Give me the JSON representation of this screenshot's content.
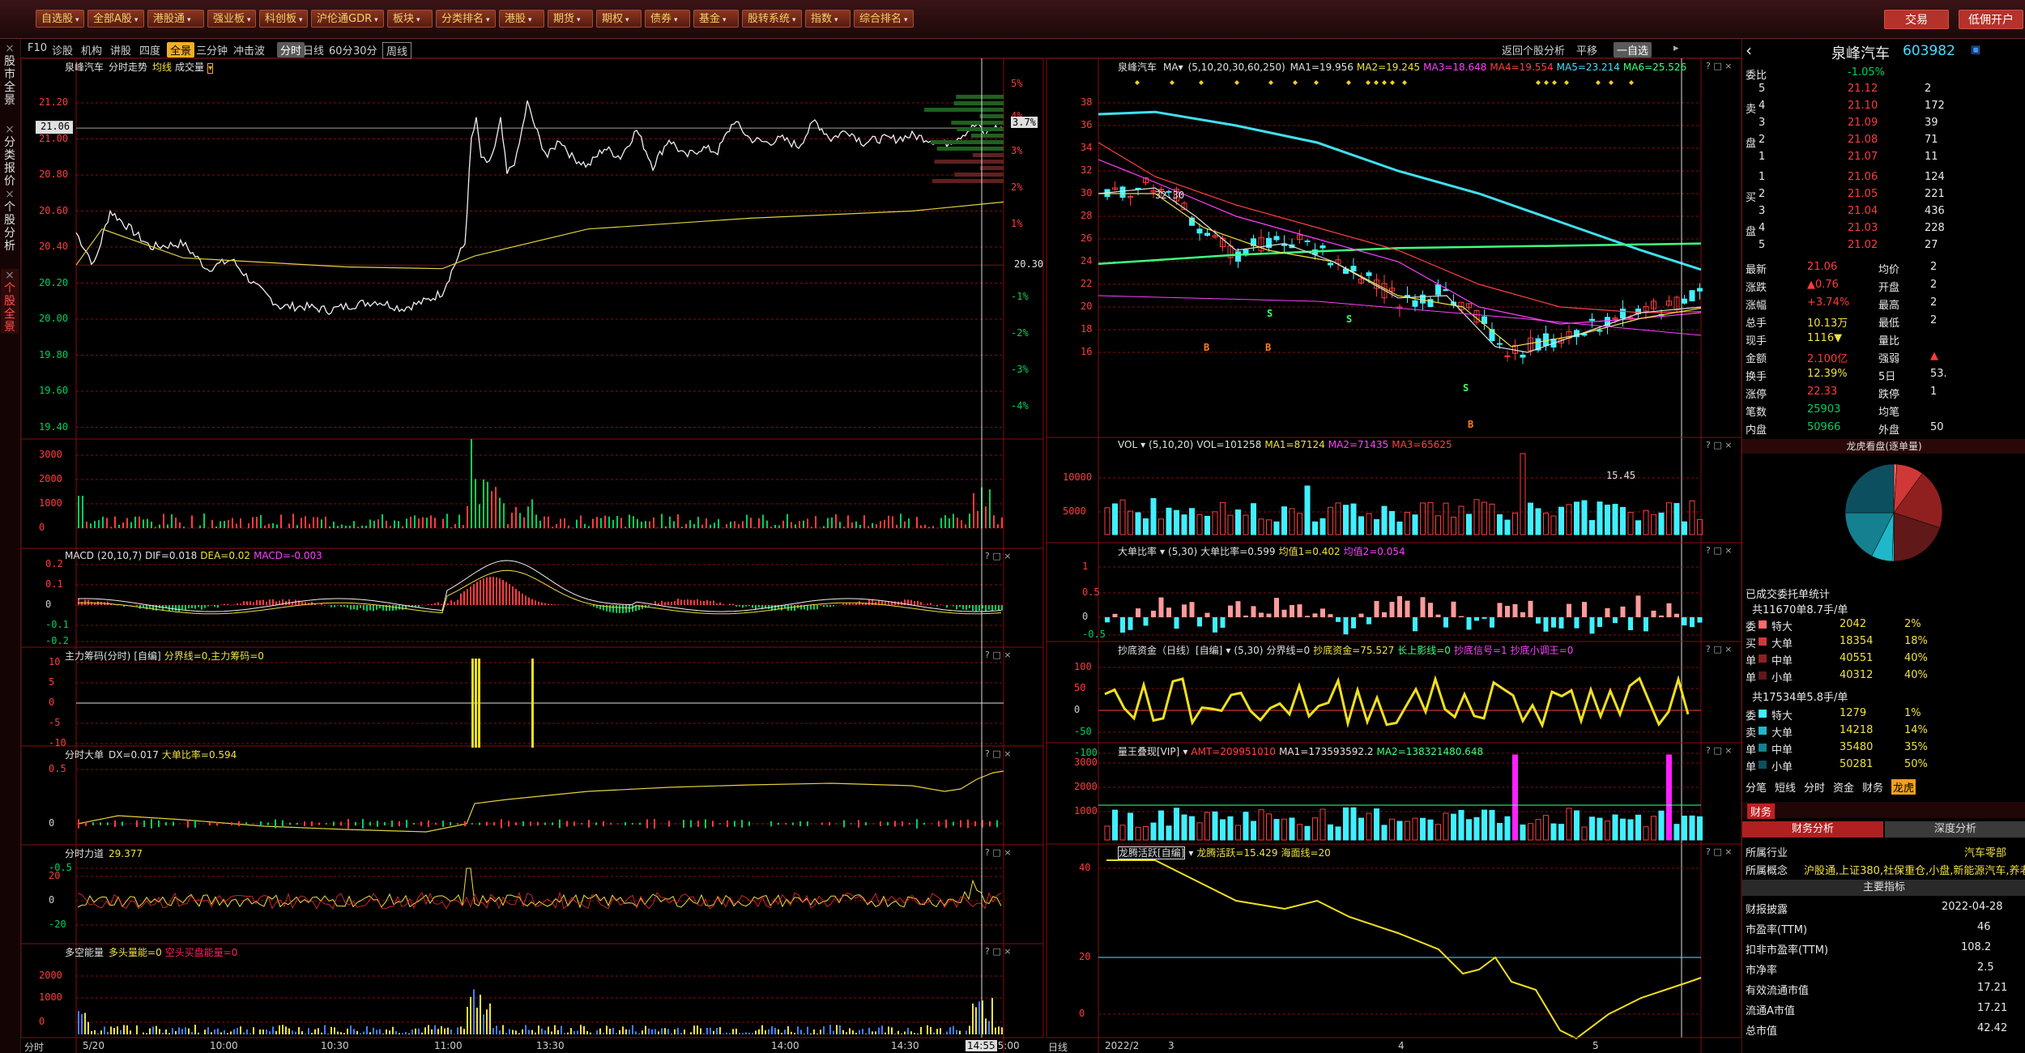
{
  "top_menu": {
    "buttons": [
      "自选股",
      "全部A股",
      "港股通",
      "强业板",
      "科创板",
      "沪伦通GDR",
      "板块",
      "分类排名",
      "港股",
      "期货",
      "期权",
      "债券",
      "基金",
      "股转系统",
      "指数",
      "综合排名"
    ],
    "right_buttons": [
      "交易",
      "低佣开户"
    ]
  },
  "left_tabs": [
    "股市全景",
    "分类报价",
    "个股分析",
    "个股全景"
  ],
  "toolbar": {
    "left": [
      "F10",
      "诊股",
      "机构",
      "讲股",
      "四度",
      "全景",
      "三分钟",
      "冲击波",
      "分时",
      "日线",
      "60分",
      "30分",
      "周线"
    ],
    "active": "全景",
    "right": [
      "返回个股分析",
      "平移",
      "一自选"
    ]
  },
  "intraday": {
    "title": "泉峰汽车",
    "subtitle": "分时走势",
    "avg_label": "均线",
    "vol_label": "成交量",
    "yticks": [
      "21.20",
      "21.00",
      "20.80",
      "20.60",
      "20.40",
      "20.20",
      "20.00",
      "19.80",
      "19.60",
      "19.40"
    ],
    "current_price": "21.06",
    "ref_price": "20.30",
    "pct_ticks": [
      "5%",
      "4%",
      "3.7%",
      "3%",
      "2%",
      "1%",
      "-1%",
      "-2%",
      "-3%",
      "-4%"
    ],
    "xticks": [
      "5/20",
      "10:00",
      "10:30",
      "11:00",
      "13:30",
      "14:00",
      "14:30",
      "14:55",
      "15:00"
    ],
    "vol_ticks": [
      "3000",
      "2000",
      "1000",
      "0"
    ],
    "xmode": "分时"
  },
  "sub_panels": [
    {
      "name": "MACD",
      "params": "(20,10,7)",
      "dif": "DIF=0.018",
      "dea": "DEA=0.02",
      "macd": "MACD=-0.003",
      "ticks": [
        "0.2",
        "0.1",
        "0",
        "-0.1",
        "-0.2"
      ]
    },
    {
      "name": "主力筹码(分时)",
      "params": "[自编]",
      "text": "分界线=0,主力筹码=0",
      "ticks": [
        "10",
        "5",
        "0",
        "-5",
        "-10"
      ]
    },
    {
      "name": "分时大单",
      "dx": "DX=0.017",
      "ratio": "大单比率=0.594",
      "ticks": [
        "0.5",
        "0",
        "-0.5"
      ]
    },
    {
      "name": "分时力道",
      "value": "29.377",
      "ticks": [
        "20",
        "0",
        "-20"
      ]
    },
    {
      "name": "多空能量",
      "bull": "多头量能=0",
      "bear": "空头买盘能量=0",
      "ticks": [
        "2000",
        "1000",
        "0"
      ]
    }
  ],
  "kline": {
    "title": "泉峰汽车",
    "ma_label": "MA",
    "ma_params": "(5,10,20,30,60,250)",
    "ma_values": [
      "MA1=19.956",
      "MA2=19.245",
      "MA3=18.648",
      "MA4=19.554",
      "MA5=23.214",
      "MA6=25.526"
    ],
    "yticks": [
      "38",
      "36",
      "34",
      "32",
      "30",
      "28",
      "26",
      "24",
      "22",
      "20",
      "18",
      "16"
    ],
    "high_label": "32.30",
    "low_label": "15.45",
    "signals": [
      "B",
      "S",
      "B",
      "S",
      "S",
      "B"
    ],
    "xticks": [
      "2022/2",
      "3",
      "4",
      "5"
    ],
    "xmode": "日线"
  },
  "kline_sub": [
    {
      "name": "VOL",
      "params": "(5,10,20)",
      "vals": [
        "VOL=101258",
        "MA1=87124",
        "MA2=71435",
        "MA3=65625"
      ],
      "ticks": [
        "10000",
        "5000"
      ]
    },
    {
      "name": "大单比率",
      "params": "(5,30)",
      "vals": [
        "大单比率=0.599",
        "均值1=0.402",
        "均值2=0.054"
      ],
      "ticks": [
        "1",
        "0.5",
        "0",
        "-0.5"
      ]
    },
    {
      "name": "抄底资金（日线）[自编]",
      "params": "(5,30)",
      "vals": [
        "分界线=0",
        "抄底资金=75.527",
        "长上影线=0",
        "抄底信号=1",
        "抄底小调王=0"
      ],
      "ticks": [
        "100",
        "50",
        "0",
        "-50",
        "-100"
      ]
    },
    {
      "name": "量王叠现[VIP]",
      "vals": [
        "AMT=209951010",
        "MA1=173593592.2",
        "MA2=138321480.648"
      ],
      "ticks": [
        "3000",
        "2000",
        "1000"
      ]
    },
    {
      "name": "龙腾活跃[自编]",
      "vals": [
        "龙腾活跃=15.429",
        "海面线=20"
      ],
      "ticks": [
        "40",
        "20",
        "0"
      ]
    }
  ],
  "quote": {
    "name": "泉峰汽车",
    "code": "603982",
    "weibi_label": "委比",
    "weibi": "-1.05%",
    "asks": [
      [
        "5",
        "21.12",
        "2"
      ],
      [
        "4",
        "21.10",
        "172"
      ],
      [
        "3",
        "21.09",
        "39"
      ],
      [
        "2",
        "21.08",
        "71"
      ],
      [
        "1",
        "21.07",
        "11"
      ]
    ],
    "bids": [
      [
        "1",
        "21.06",
        "124"
      ],
      [
        "2",
        "21.05",
        "221"
      ],
      [
        "3",
        "21.04",
        "436"
      ],
      [
        "4",
        "21.03",
        "228"
      ],
      [
        "5",
        "21.02",
        "27"
      ]
    ],
    "ask_side": [
      "卖",
      "盘"
    ],
    "bid_side": [
      "买",
      "盘"
    ],
    "stats": [
      [
        "最新",
        "21.06",
        "均价",
        "2"
      ],
      [
        "涨跌",
        "▲0.76",
        "开盘",
        "2"
      ],
      [
        "涨幅",
        "+3.74%",
        "最高",
        "2"
      ],
      [
        "总手",
        "10.13万",
        "最低",
        "2"
      ],
      [
        "现手",
        "1116▼",
        "量比",
        ""
      ],
      [
        "金额",
        "2.100亿",
        "强弱",
        "▲"
      ],
      [
        "换手",
        "12.39%",
        "5日",
        "53."
      ],
      [
        "涨停",
        "22.33",
        "跌停",
        "1"
      ],
      [
        "笔数",
        "25903",
        "均笔",
        ""
      ],
      [
        "内盘",
        "50966",
        "外盘",
        "50"
      ]
    ]
  },
  "order_stats": {
    "pie_title": "龙虎看盘(逐单量)",
    "section_title": "已成交委托单统计",
    "buy_total": "共11670单8.7手/单",
    "buy_side": [
      "委",
      "买",
      "单"
    ],
    "buy": [
      [
        "特大",
        "2042",
        "2%"
      ],
      [
        "大单",
        "18354",
        "18%"
      ],
      [
        "中单",
        "40551",
        "40%"
      ],
      [
        "小单",
        "40312",
        "40%"
      ]
    ],
    "sell_total": "共17534单5.8手/单",
    "sell_side": [
      "委",
      "卖",
      "单"
    ],
    "sell": [
      [
        "特大",
        "1279",
        "1%"
      ],
      [
        "大单",
        "14218",
        "14%"
      ],
      [
        "中单",
        "35480",
        "35%"
      ],
      [
        "小单",
        "50281",
        "50%"
      ]
    ],
    "pie_slices": [
      {
        "label": "特大买",
        "value": 2,
        "color": "#ff6a6a"
      },
      {
        "label": "大单买",
        "value": 18,
        "color": "#d03838"
      },
      {
        "label": "中单买",
        "value": 40,
        "color": "#902020"
      },
      {
        "label": "小单买",
        "value": 40,
        "color": "#601818"
      },
      {
        "label": "特大卖",
        "value": 1,
        "color": "#40f0ff"
      },
      {
        "label": "大单卖",
        "value": 14,
        "color": "#20b8c8"
      },
      {
        "label": "中单卖",
        "value": 35,
        "color": "#148090"
      },
      {
        "label": "小单卖",
        "value": 50,
        "color": "#0c5060"
      }
    ]
  },
  "bottom_tabs": [
    "分笔",
    "短线",
    "分时",
    "资金",
    "财务",
    "龙虎"
  ],
  "bottom_active": "龙虎",
  "finance": {
    "tab": "财务",
    "subtabs": [
      "财务分析",
      "深度分析"
    ],
    "industry_label": "所属行业",
    "industry": "汽车零部",
    "concept_label": "所属概念",
    "concept": "沪股通,上证380,社保重仓,小盘,新能源汽车,养老",
    "main_title": "主要指标",
    "rows": [
      [
        "财报披露",
        "2022-04-28"
      ],
      [
        "市盈率(TTM)",
        "46"
      ],
      [
        "扣非市盈率(TTM)",
        "108.2"
      ],
      [
        "市净率",
        "2.5"
      ],
      [
        "有效流通市值",
        "17.21"
      ],
      [
        "流通A市值",
        "17.21"
      ],
      [
        "总市值",
        "42.42"
      ]
    ]
  },
  "colors": {
    "up": "#ff3c3c",
    "down": "#40f0ff",
    "avg": "#f0e040",
    "grid": "#5a0c0c"
  }
}
